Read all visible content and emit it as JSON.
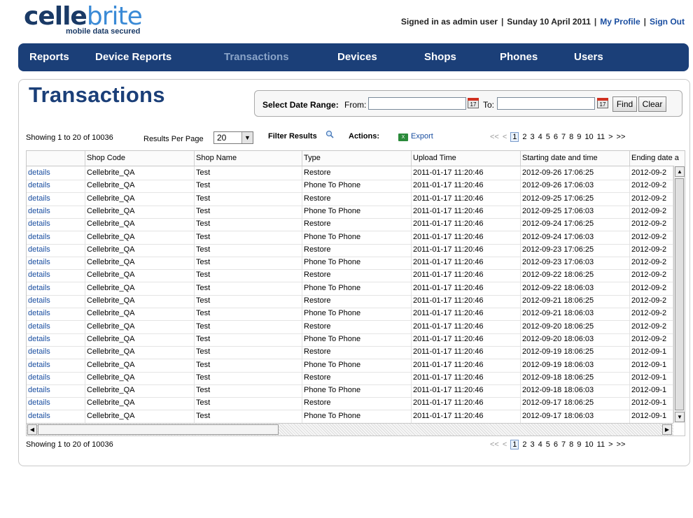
{
  "logo": {
    "part1": "celle",
    "part2": "brite",
    "tagline": "mobile data secured"
  },
  "userbar": {
    "signed_in": "Signed in as admin user",
    "date": "Sunday 10 April 2011",
    "my_profile": "My Profile",
    "sign_out": "Sign Out",
    "separator": "|"
  },
  "nav": {
    "items": [
      "Reports",
      "Device Reports",
      "Transactions",
      "Devices",
      "Shops",
      "Phones",
      "Users"
    ],
    "active": "Transactions"
  },
  "page_title": "Transactions",
  "date_range": {
    "label": "Select Date Range:",
    "from_label": "From:",
    "from_value": "",
    "to_label": "To:",
    "to_value": "",
    "calendar_day": "17",
    "find": "Find",
    "clear": "Clear"
  },
  "toolbar": {
    "showing": "Showing 1 to 20 of 10036",
    "results_per_page_label": "Results Per Page",
    "results_per_page": "20",
    "filter_results": "Filter Results",
    "actions_label": "Actions:",
    "export": "Export"
  },
  "pager": {
    "first": "<<",
    "prev": "<",
    "pages": [
      "1",
      "2",
      "3",
      "4",
      "5",
      "6",
      "7",
      "8",
      "9",
      "10",
      "11"
    ],
    "current": "1",
    "next": ">",
    "last": ">>"
  },
  "table": {
    "columns": [
      "",
      "Shop Code",
      "Shop Name",
      "Type",
      "Upload Time",
      "Starting date and time",
      "Ending date a"
    ],
    "rows": [
      [
        "details",
        "Cellebrite_QA",
        "Test",
        "Restore",
        "2011-01-17 11:20:46",
        "2012-09-26 17:06:25",
        "2012-09-2"
      ],
      [
        "details",
        "Cellebrite_QA",
        "Test",
        "Phone To Phone",
        "2011-01-17 11:20:46",
        "2012-09-26 17:06:03",
        "2012-09-2"
      ],
      [
        "details",
        "Cellebrite_QA",
        "Test",
        "Restore",
        "2011-01-17 11:20:46",
        "2012-09-25 17:06:25",
        "2012-09-2"
      ],
      [
        "details",
        "Cellebrite_QA",
        "Test",
        "Phone To Phone",
        "2011-01-17 11:20:46",
        "2012-09-25 17:06:03",
        "2012-09-2"
      ],
      [
        "details",
        "Cellebrite_QA",
        "Test",
        "Restore",
        "2011-01-17 11:20:46",
        "2012-09-24 17:06:25",
        "2012-09-2"
      ],
      [
        "details",
        "Cellebrite_QA",
        "Test",
        "Phone To Phone",
        "2011-01-17 11:20:46",
        "2012-09-24 17:06:03",
        "2012-09-2"
      ],
      [
        "details",
        "Cellebrite_QA",
        "Test",
        "Restore",
        "2011-01-17 11:20:46",
        "2012-09-23 17:06:25",
        "2012-09-2"
      ],
      [
        "details",
        "Cellebrite_QA",
        "Test",
        "Phone To Phone",
        "2011-01-17 11:20:46",
        "2012-09-23 17:06:03",
        "2012-09-2"
      ],
      [
        "details",
        "Cellebrite_QA",
        "Test",
        "Restore",
        "2011-01-17 11:20:46",
        "2012-09-22 18:06:25",
        "2012-09-2"
      ],
      [
        "details",
        "Cellebrite_QA",
        "Test",
        "Phone To Phone",
        "2011-01-17 11:20:46",
        "2012-09-22 18:06:03",
        "2012-09-2"
      ],
      [
        "details",
        "Cellebrite_QA",
        "Test",
        "Restore",
        "2011-01-17 11:20:46",
        "2012-09-21 18:06:25",
        "2012-09-2"
      ],
      [
        "details",
        "Cellebrite_QA",
        "Test",
        "Phone To Phone",
        "2011-01-17 11:20:46",
        "2012-09-21 18:06:03",
        "2012-09-2"
      ],
      [
        "details",
        "Cellebrite_QA",
        "Test",
        "Restore",
        "2011-01-17 11:20:46",
        "2012-09-20 18:06:25",
        "2012-09-2"
      ],
      [
        "details",
        "Cellebrite_QA",
        "Test",
        "Phone To Phone",
        "2011-01-17 11:20:46",
        "2012-09-20 18:06:03",
        "2012-09-2"
      ],
      [
        "details",
        "Cellebrite_QA",
        "Test",
        "Restore",
        "2011-01-17 11:20:46",
        "2012-09-19 18:06:25",
        "2012-09-1"
      ],
      [
        "details",
        "Cellebrite_QA",
        "Test",
        "Phone To Phone",
        "2011-01-17 11:20:46",
        "2012-09-19 18:06:03",
        "2012-09-1"
      ],
      [
        "details",
        "Cellebrite_QA",
        "Test",
        "Restore",
        "2011-01-17 11:20:46",
        "2012-09-18 18:06:25",
        "2012-09-1"
      ],
      [
        "details",
        "Cellebrite_QA",
        "Test",
        "Phone To Phone",
        "2011-01-17 11:20:46",
        "2012-09-18 18:06:03",
        "2012-09-1"
      ],
      [
        "details",
        "Cellebrite_QA",
        "Test",
        "Restore",
        "2011-01-17 11:20:46",
        "2012-09-17 18:06:25",
        "2012-09-1"
      ],
      [
        "details",
        "Cellebrite_QA",
        "Test",
        "Phone To Phone",
        "2011-01-17 11:20:46",
        "2012-09-17 18:06:03",
        "2012-09-1"
      ]
    ]
  },
  "footer": {
    "showing": "Showing 1 to 20 of 10036"
  },
  "colors": {
    "nav_bg": "#1b3f78",
    "title": "#1b3f78",
    "link": "#1a4ea0",
    "active_nav": "#8aa4c8"
  },
  "icons": [
    "calendar-icon",
    "magnifier-icon",
    "excel-export-icon",
    "chevron-down-icon",
    "scroll-up-icon",
    "scroll-down-icon",
    "scroll-left-icon",
    "scroll-right-icon"
  ]
}
